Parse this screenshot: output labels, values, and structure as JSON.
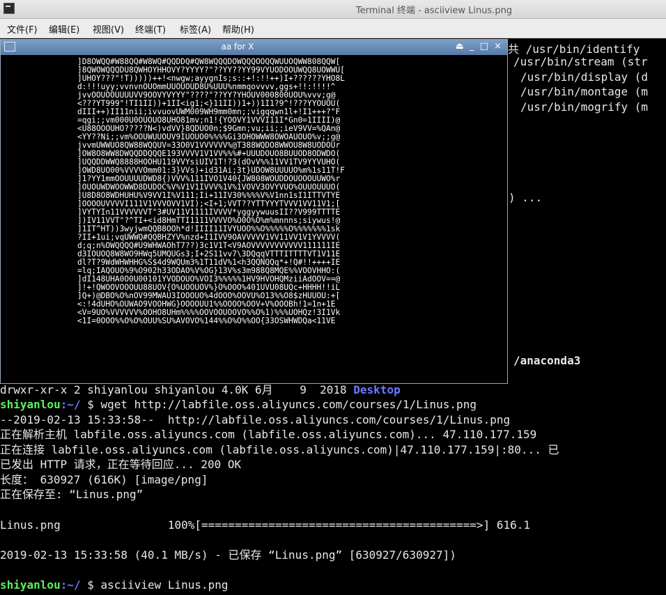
{
  "window": {
    "title": "Terminal 终端 - asciiview Linus.png"
  },
  "menu": [
    "文件(F)",
    "编辑(E)",
    "视图(V)",
    "终端(T)",
    "标签(A)",
    "帮助(H)"
  ],
  "background_fragments": {
    "identify": "共 /usr/bin/identify",
    "stream": "/usr/bin/stream (str",
    "display": "/usr/bin/display (d",
    "montage": "/usr/bin/montage (m",
    "mogrify": "/usr/bin/mogrify (m",
    "ellipsis": ") ...",
    "anaconda": "/anaconda3"
  },
  "terminal": {
    "ls_line_prefix": "drwxr-xr-x 2 shiyanlou shiyanlou 4.0K 6月    9  2018 ",
    "ls_line_dir": "Desktop",
    "prompt_user": "shiyanlou",
    "prompt_path": ":~/",
    "prompt_symbol": " $ ",
    "cmd1": "wget http://labfile.oss.aliyuncs.com/courses/1/Linus.png",
    "out1": "--2019-02-13 15:33:58--  http://labfile.oss.aliyuncs.com/courses/1/Linus.png",
    "out2": "正在解析主机 labfile.oss.aliyuncs.com (labfile.oss.aliyuncs.com)... 47.110.177.159",
    "out3": "正在连接 labfile.oss.aliyuncs.com (labfile.oss.aliyuncs.com)|47.110.177.159|:80... 已",
    "out4": "已发出 HTTP 请求，正在等待回应... 200 OK",
    "out5": "长度： 630927 (616K) [image/png]",
    "out6": "正在保存至: “Linus.png”",
    "progress": "Linus.png                100%[=========================================>] 616.1",
    "out7": "2019-02-13 15:33:58 (40.1 MB/s) - 已保存 “Linus.png” [630927/630927])",
    "cmd2": "asciiview Linus.png"
  },
  "aawindow": {
    "title": "aa for X",
    "controls": "⏏ _ □ ×",
    "art_lines": [
      "]D8OWQQ#W88QQ#W8WQ#QQDDQ#QW8WQQQDOWQQQOOQQWUUOQWW808QQW[",
      "]8QWOWQQQDU8QWHOYHHOVY?YYYY?\"??YY??YY99VYUODOOUWQQ8UOWWU[",
      "]UHOY???\"!T)))))++!<nwgw;ayygnIs;s::+!:!!++)I+??????YHO8L",
      "d:!!!uyy;vvnvnOUOmmUUOUOUD8U%UUU%nmmqovvvv,ggs+!!:!!!!^",
      "jvvOOUOOUUUUVV9OOVYVYYY\"????\"??YY?YHOUV000800UOU%vvv;g@",
      "<???YT999\"!TI1II))+1II<ig1;<}11II))1+))1I1?9^!???YYOUOU(",
      "dIII++)II11nii;ivvuovUWM009WH9mm0mn;;vigqqwn1l+!I1+++?\"F",
      "=qgi;;vm000U0OUOUO8UHO81mv;n1!{YOOVY1VVVI11I*Gn0=1IIII)@",
      "<U88OOOUHO?????N<)vdVV}8QDUO0n;$9Gmn;vu;ii;;ieV9VV=%QAn@",
      "<YY??Ni;;vm%OOUWUUOUV9IUOUO0%%%%Gi3OHOWWW8OWOAUOUO%v;;g@",
      "jvvmUWWUO8QW88WQQUV=33O0V1VVVVVV%@T388WQDO8WWOU8W8UODOUr",
      "]OW8O8WW8DWQQDDQQQE193VVVV1V1VV%%%#+UUUDOUO8BUUOD8ODWDO(",
      "]UQQDDWWQ8888HOOHU119VVYsiUIV1T!?3(dOvV%%11VV1TV9YYVUHO(",
      "]OWD8UO00%VVVVOmm01:3}VVs)+id31Ai;3t}UDOW8UUUUO%m%1s11T!F",
      "]1?YY1mmOOUUUUDWD8{)VVV%111IVO1V40{JW808WOUDDOUOOOUUWO%r",
      "]OUOUWDWOOWWD8DUDOC%V%V1V1IVVV%1V%1VOVV3OVYVUO%OUUOUUUO(",
      "]U8D8O8WDHUHU%V9VV1I%V111;Ii+11IV30%%%%V%V1nn1sI1ITTVTYE",
      "]OOOOUVVVVI111V1VVVOVV1VI);<I+1;VVT??YTTYYYTVVV1VV11V1;[",
      "]VYTYIn11VVVVVVT\"3#UV11V1111IVVVV*yggyywuusII??V999TTTTE",
      "])IV11VVT\"?^TI+<id8HmTTI1111VVVVO%O0O%O%m%mnnns;siywus!@",
      "]1IT^HT))3wyjwmQQB8OOh*d!IIII11IVYUOO%%O%%%%%O%%%%%%%1sk",
      "?II+1ui;vqUWWQ#QQBHZYV%nzd+I1IVV9OAVVVVV1VV11VV1V1YVVVV(",
      "d;q;n%OWQQQQ#U9WHWAOhT7??)3c1V1T<V9AOVVVVVVVVVVV111111IE",
      "d3IOUOQ8W8WO9HWq5UMQUGs3;I+2S11vv7\\3DQqqVTTTITTTTVT1V11E",
      "dl?T?9WdWHWHHG%S$4d9WQUm3%1T11dV%1<h3QQNQQq*+!Q#!!++++IE",
      "=lq;IAQOUO%9%O902h33ODAO%V%OG}13V%s3m988Q8MQE%%VOOVHHO:(",
      "]dI148UHA0O0U00101YVODOUO%VOI3%%%%%1HV9HVOHQMziiAdOOV==@",
      "]!+!QWOOVOOOUU88UOV{O%UOOUOV%}O%OOO%401UVU08UQc+HHHH!!iL",
      "]Q+)@DBO%O%nOV99MWAU3IOOOUO%4dOOO%OOVU%O13%%O8$zHUUOU:+[",
      "<:!4dUHO%OUWAO9VOOHWG}OOOOUU1%%OOOO%OOV+V%OOOBh!1=1n+1E",
      "<V=9UO%VVVVVV%OOHO8UHm%%%%OOVOOUOOVO%%O%1)%%%UOHQz!3I1Vk",
      "<1I=0OOO%%O%O%OUU%SU%AVOVO%144%%O%O%%OO{33OSWHWDQa<11VE"
    ]
  }
}
